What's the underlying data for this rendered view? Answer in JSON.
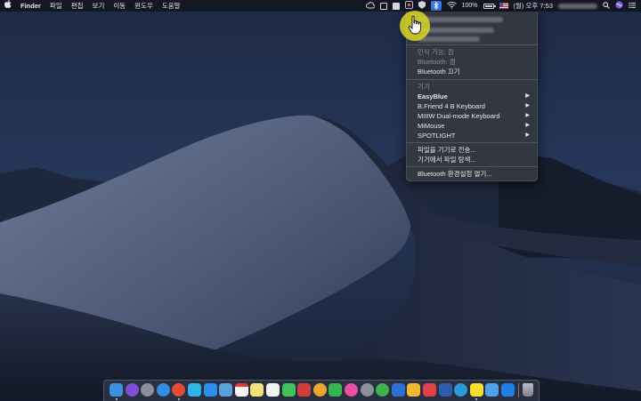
{
  "menubar": {
    "apple_icon": "apple-icon",
    "app_name": "Finder",
    "items": [
      "파일",
      "편집",
      "보기",
      "이동",
      "윈도우",
      "도움말"
    ],
    "battery": "100%",
    "clock": "(월) 오후 7:53"
  },
  "bluetooth_menu": {
    "status_line": "인식 가능: 끔",
    "bluetooth_state": "Bluetooth: 켬",
    "toggle": "Bluetooth 끄기",
    "devices_header": "기기",
    "devices": [
      {
        "name": "EasyBlue",
        "bold": true
      },
      {
        "name": "B.Friend 4 B Keyboard",
        "bold": false
      },
      {
        "name": "MIIIW Dual-mode Keyboard",
        "bold": false
      },
      {
        "name": "MiMouse",
        "bold": false
      },
      {
        "name": "SPOTLIGHT",
        "bold": false
      }
    ],
    "send_file": "파일을 기기로 전송...",
    "browse_files": "기기에서 파일 탐색...",
    "open_prefs": "Bluetooth 환경설정 열기..."
  },
  "colors": {
    "highlight": "#d6d428",
    "bluetooth_active": "#3b7cf0"
  },
  "dock": {
    "icons": [
      {
        "name": "finder-icon",
        "color": "#3d8fe0",
        "running": true
      },
      {
        "name": "siri-icon",
        "color": "#7b4fd8",
        "running": false
      },
      {
        "name": "launchpad-icon",
        "color": "#8a8f9a",
        "running": false
      },
      {
        "name": "safari-icon",
        "color": "#2f8de6",
        "running": false
      },
      {
        "name": "chrome-icon",
        "color": "#e44b36",
        "running": true
      },
      {
        "name": "twitter-icon",
        "color": "#2fb4e8",
        "running": false
      },
      {
        "name": "app-store-icon",
        "color": "#2a8ff0",
        "running": false
      },
      {
        "name": "preview-icon",
        "color": "#5ba0d8",
        "running": false
      },
      {
        "name": "calendar-icon",
        "color": "#f4f4f4",
        "running": false
      },
      {
        "name": "notes-icon",
        "color": "#f5e27a",
        "running": false
      },
      {
        "name": "reminders-icon",
        "color": "#f2f2f2",
        "running": false
      },
      {
        "name": "messages-icon",
        "color": "#3fc45b",
        "running": false
      },
      {
        "name": "photo-booth-icon",
        "color": "#d23c3c",
        "running": false
      },
      {
        "name": "photos-icon",
        "color": "#f0a430",
        "running": false
      },
      {
        "name": "facetime-icon",
        "color": "#35b54d",
        "running": false
      },
      {
        "name": "itunes-icon",
        "color": "#e94fa4",
        "running": false
      },
      {
        "name": "system-preferences-icon",
        "color": "#8d9099",
        "running": false
      },
      {
        "name": "evernote-icon",
        "color": "#3db24e",
        "running": false
      },
      {
        "name": "marketing-app-icon",
        "color": "#2a6fd6",
        "running": false
      },
      {
        "name": "keep-icon",
        "color": "#f2b830",
        "running": false
      },
      {
        "name": "pocket-icon",
        "color": "#e0404a",
        "running": false
      },
      {
        "name": "word-icon",
        "color": "#2b5fad",
        "running": false
      },
      {
        "name": "edge-icon",
        "color": "#2a9bd8",
        "running": false
      },
      {
        "name": "kakaotalk-icon",
        "color": "#f8df2e",
        "running": true
      },
      {
        "name": "icloud-icon",
        "color": "#4aa3ec",
        "running": false
      },
      {
        "name": "teamviewer-icon",
        "color": "#1e7fe6",
        "running": false
      },
      {
        "name": "trash-icon",
        "color": "#9aa0aa",
        "running": false
      }
    ]
  }
}
